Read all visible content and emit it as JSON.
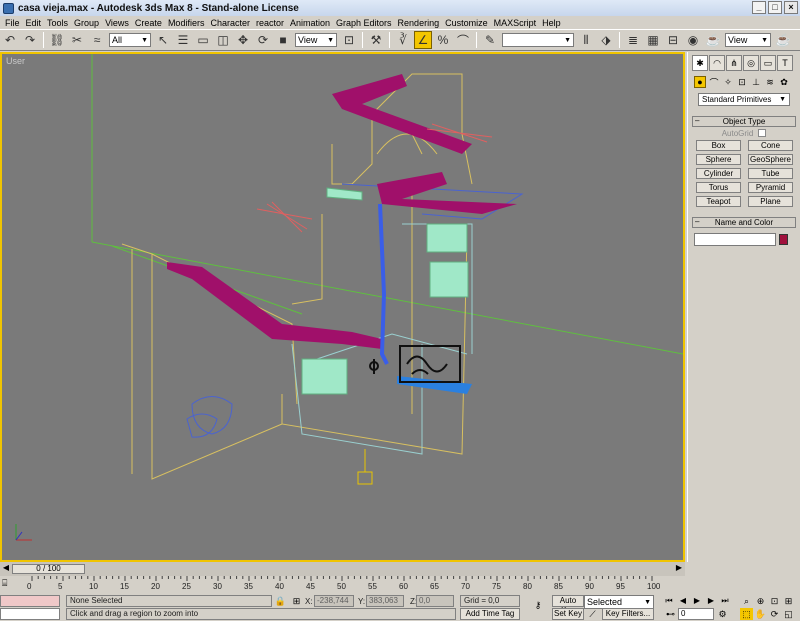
{
  "window": {
    "title": "casa vieja.max - Autodesk 3ds Max 8  - Stand-alone License"
  },
  "menu": [
    "File",
    "Edit",
    "Tools",
    "Group",
    "Views",
    "Create",
    "Modifiers",
    "Character",
    "reactor",
    "Animation",
    "Graph Editors",
    "Rendering",
    "Customize",
    "MAXScript",
    "Help"
  ],
  "toolbar": {
    "selection_filter": "All",
    "ref_coord": "View",
    "named_sel": "",
    "render_view": "View"
  },
  "viewport": {
    "label": "User"
  },
  "command_panel": {
    "category": "Standard Primitives",
    "object_type_header": "Object Type",
    "autogrid_label": "AutoGrid",
    "buttons": [
      "Box",
      "Cone",
      "Sphere",
      "GeoSphere",
      "Cylinder",
      "Tube",
      "Torus",
      "Pyramid",
      "Teapot",
      "Plane"
    ],
    "name_color_header": "Name and Color",
    "object_color": "#a0103c"
  },
  "timeline": {
    "frame_display": "0 / 100",
    "ruler_ticks": [
      "0",
      "5",
      "10",
      "15",
      "20",
      "25",
      "30",
      "35",
      "40",
      "45",
      "50",
      "55",
      "60",
      "65",
      "70",
      "75",
      "80",
      "85",
      "90",
      "95",
      "100"
    ]
  },
  "status": {
    "selection": "None Selected",
    "prompt": "Click and drag a region to zoom into",
    "x_label": "X:",
    "x_value": "-238,744",
    "y_label": "Y:",
    "y_value": "383,063",
    "z_label": "Z:",
    "z_value": "0,0",
    "grid": "Grid = 0,0",
    "add_time_tag": "Add Time Tag",
    "auto_key": "Auto Key",
    "set_key": "Set Key",
    "key_mode": "Selected",
    "key_filters": "Key Filters...",
    "current_frame": "0"
  }
}
